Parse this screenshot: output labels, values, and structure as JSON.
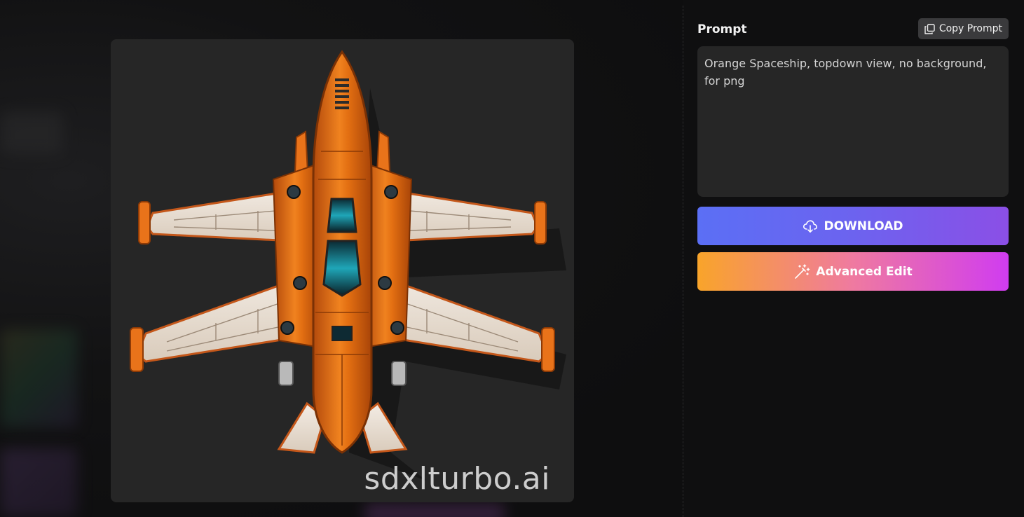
{
  "prompt_panel": {
    "title": "Prompt",
    "copy_label": "Copy Prompt",
    "copy_icon": "copy-icon",
    "prompt_text": "Orange Spaceship, topdown view, no background, for png"
  },
  "actions": {
    "download_label": "DOWNLOAD",
    "download_icon": "cloud-download-icon",
    "edit_label": "Advanced Edit",
    "edit_icon": "magic-wand-icon"
  },
  "image": {
    "watermark": "sdxlturbo.ai",
    "subject": "orange-spaceship-icon"
  },
  "colors": {
    "download_gradient": [
      "#5b6ff5",
      "#8b4fe6"
    ],
    "edit_gradient": [
      "#f9a42a",
      "#d03cf0"
    ],
    "panel_bg": "#262626",
    "page_bg": "#0f0f10"
  }
}
